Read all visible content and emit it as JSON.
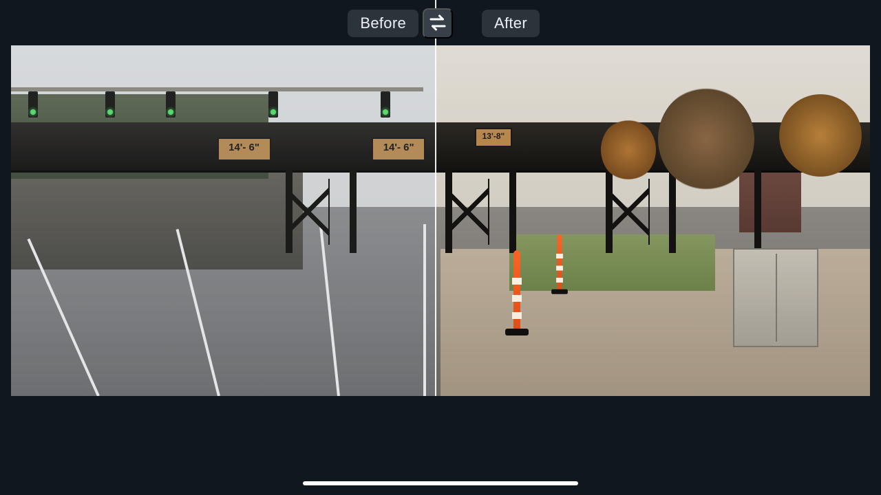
{
  "compare": {
    "before_label": "Before",
    "after_label": "After"
  },
  "signs": {
    "left": "14'- 6\"",
    "right": "14'- 6\"",
    "far": "13'-8\""
  }
}
